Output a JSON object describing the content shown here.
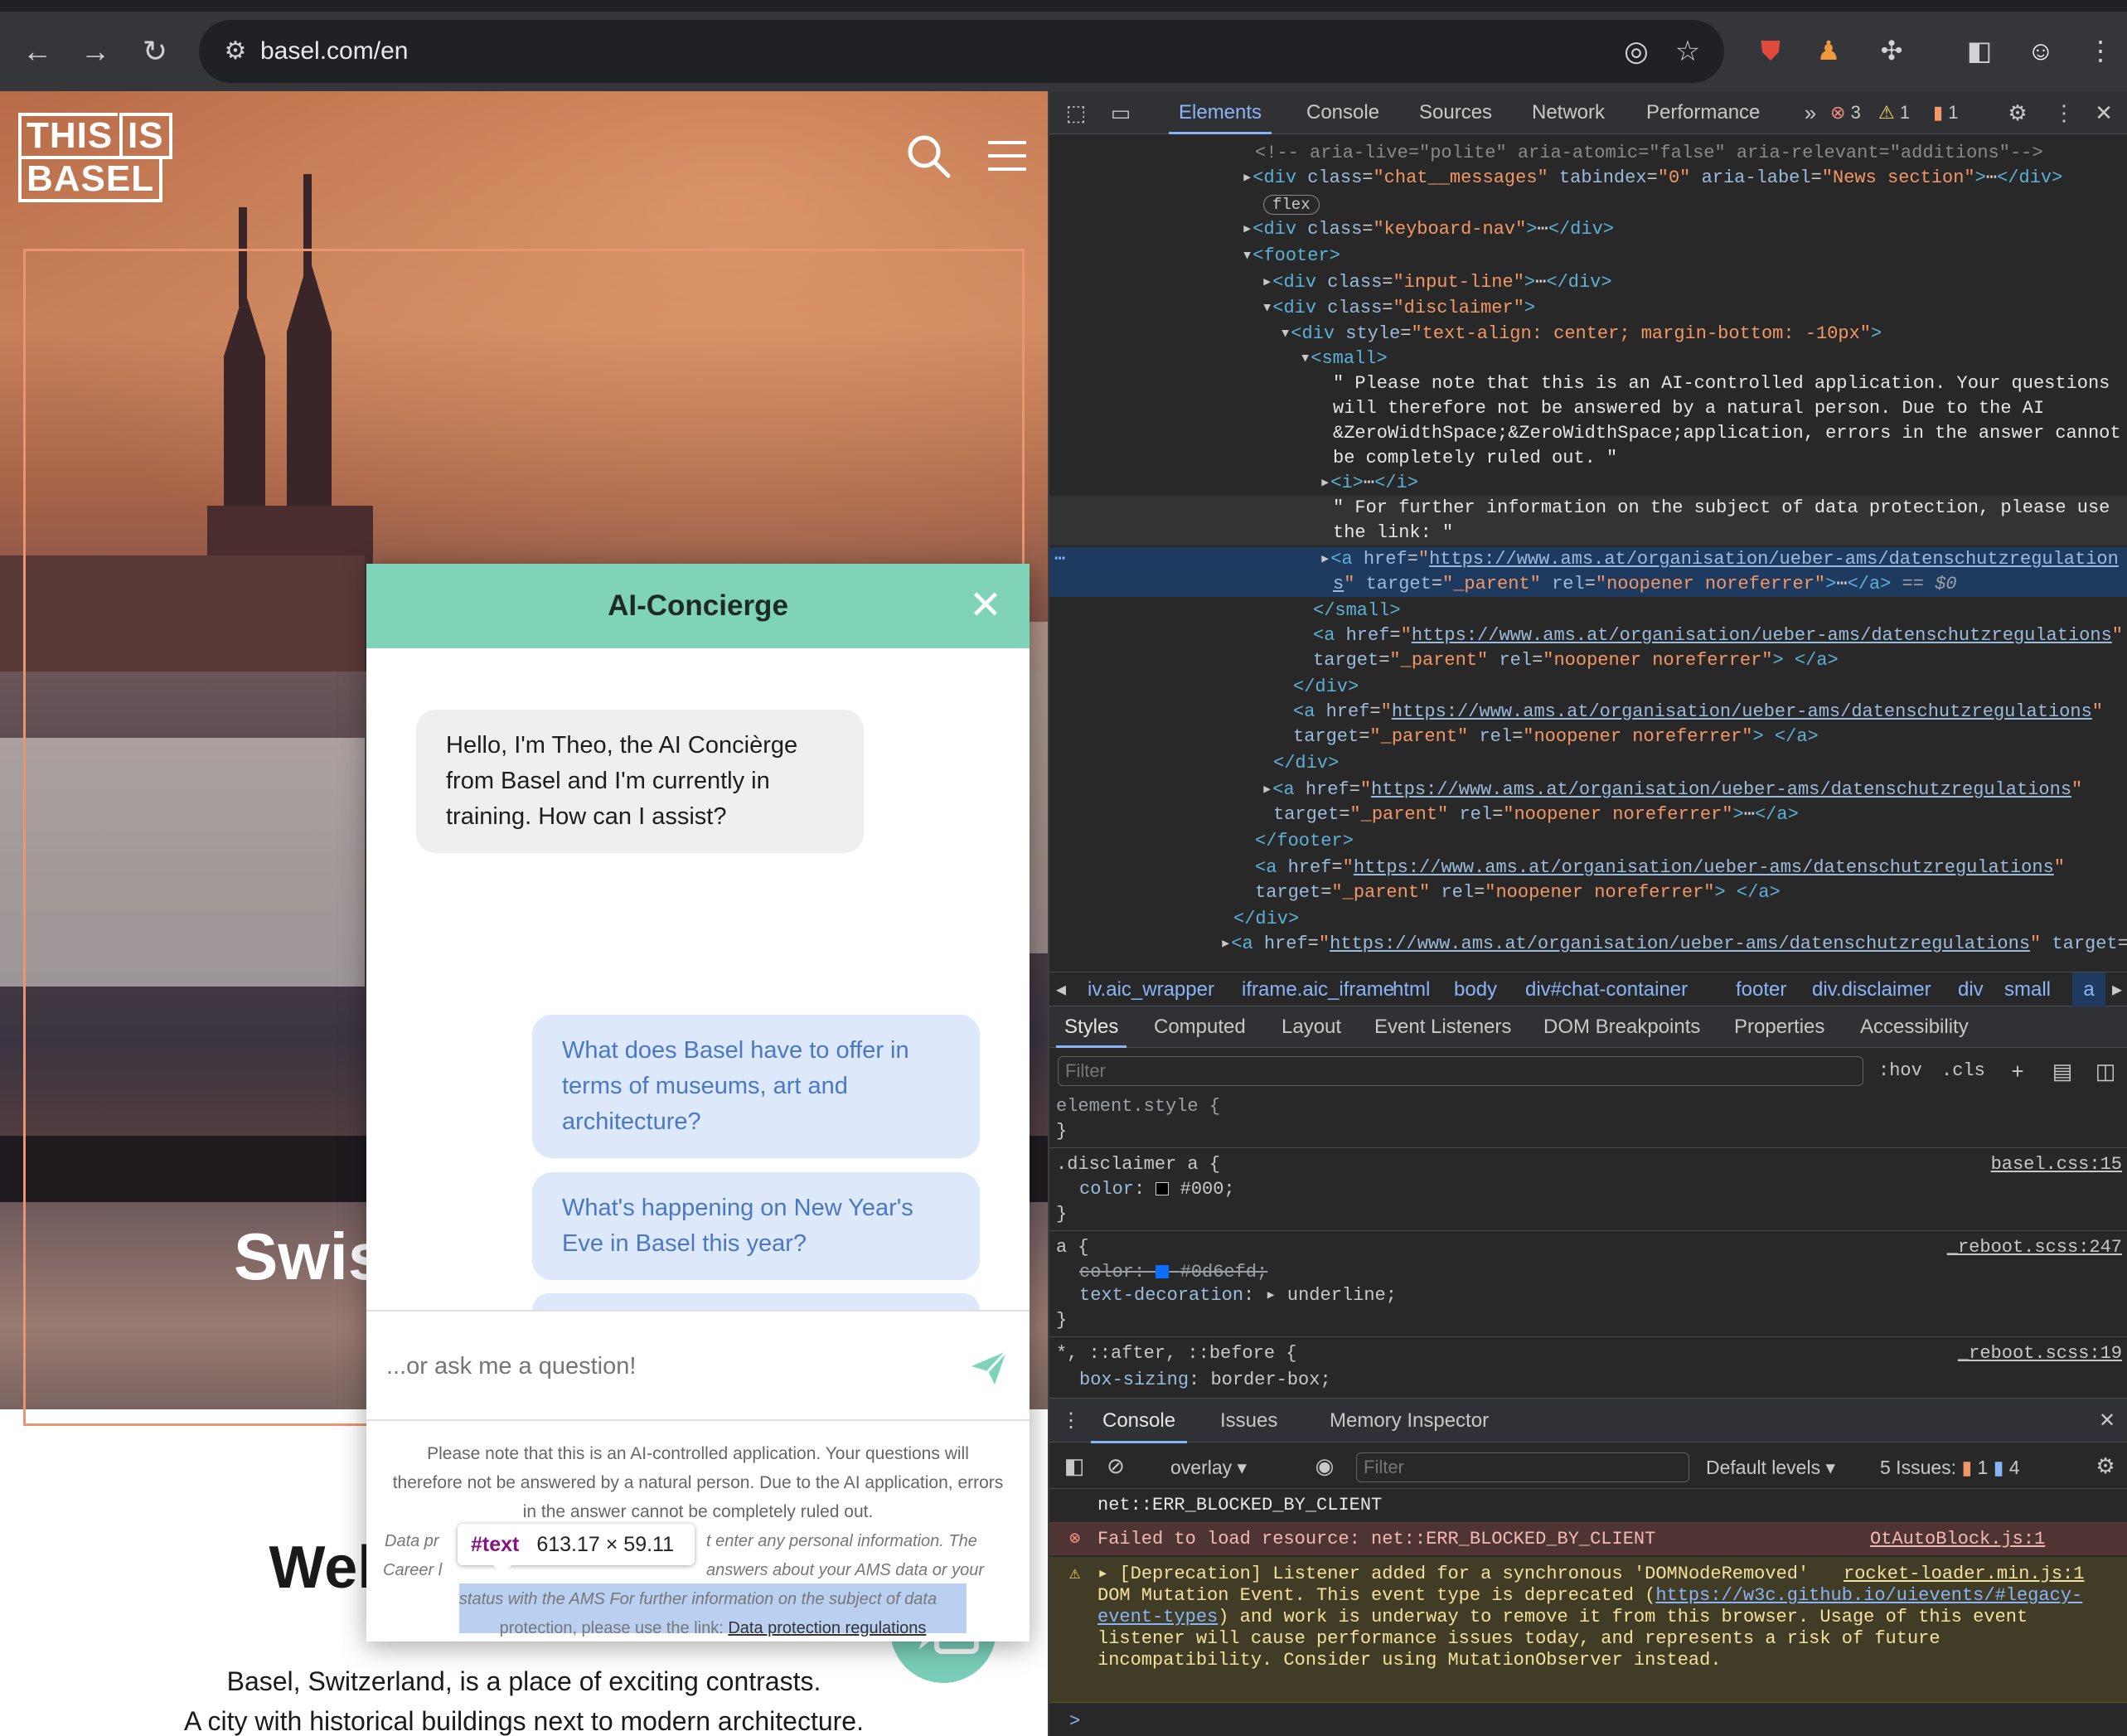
{
  "browser": {
    "url": "basel.com/en"
  },
  "site": {
    "logo_line1a": "THIS",
    "logo_line1b": "IS",
    "logo_line2": "BASEL",
    "hero_heading": "Swis",
    "welcome": "Welcome to Basel",
    "intro_line1": "Basel, Switzerland, is a place of exciting contrasts.",
    "intro_line2": "A city with historical buildings next to modern architecture."
  },
  "chat": {
    "title": "AI-Concierge",
    "bot_message": "Hello, I'm Theo, the AI Concièrge from Basel and I'm currently in training. How can I assist?",
    "suggestion1": "What does Basel have to offer in terms of museums, art and architecture?",
    "suggestion2": "What's happening on New Year's Eve in Basel this year?",
    "input_placeholder": "...or ask me a question!",
    "disclaimer": "Please note that this is an AI-controlled application. Your questions will therefore not be answered by a natural person. Due to the AI application, errors in the answer cannot be completely ruled out.",
    "disclaimer_sub_a": "Data pr",
    "disclaimer_sub_b": "t enter any personal information. The",
    "disclaimer_sub_c": "Career l",
    "disclaimer_sub_d": "answers about your AMS data or your",
    "disclaimer_sub_e": "status with the AMS For further information on the subject of data",
    "disclaimer_sub_f": "protection, please use the link:",
    "disclaimer_link": "Data protection regulations",
    "tooltip_node": "#text",
    "tooltip_size": "613.17 × 59.11"
  },
  "devtools": {
    "tabs": [
      "Elements",
      "Console",
      "Sources",
      "Network",
      "Performance"
    ],
    "errors": "3",
    "warnings": "1",
    "issues": "1",
    "breadcrumbs": [
      "iv.aic_wrapper",
      "iframe.aic_iframe",
      "html",
      "body",
      "div#chat-container",
      "footer",
      "div.disclaimer",
      "div",
      "small",
      "a"
    ],
    "style_tabs": [
      "Styles",
      "Computed",
      "Layout",
      "Event Listeners",
      "DOM Breakpoints",
      "Properties",
      "Accessibility"
    ],
    "filter_placeholder": "Filter",
    "hov": ":hov",
    "cls": ".cls",
    "drawer_tabs": [
      "Console",
      "Issues",
      "Memory Inspector"
    ],
    "console_context": "overlay",
    "console_filter_placeholder": "Filter",
    "default_levels": "Default levels",
    "issues_label": "5 Issues:",
    "issues_warn": "1",
    "issues_info": "4",
    "console_line0": "net::ERR_BLOCKED_BY_CLIENT",
    "console_error": "Failed to load resource: net::ERR_BLOCKED_BY_CLIENT",
    "console_error_src": "OtAutoBlock.js:1",
    "console_warn1": "[Deprecation] Listener added for a synchronous 'DOMNodeRemoved'",
    "console_warn_src": "rocket-loader.min.js:1",
    "console_warn2": "DOM Mutation Event. This event type is deprecated (",
    "console_warn_link1": "https://w3c.github.io/uievents/#legacy-",
    "console_warn_link2": "event-types",
    "console_warn3": ") and work is underway to remove it from this browser. Usage of this event",
    "console_warn4": "listener will cause performance issues today, and represents a risk of future",
    "console_warn5": "incompatibility. Consider using MutationObserver instead.",
    "prompt": ">"
  },
  "dom_lines": {
    "l0": "<!-- aria-live=\"polite\" aria-atomic=\"false\" aria-relevant=\"additions\"-->",
    "flex": "flex",
    "t1": " Please note that this is an AI-controlled application. Your questions",
    "t2": "will therefore not be answered by a natural person. Due to the AI",
    "t3": "&ZeroWidthSpace;&ZeroWidthSpace;application, errors in the answer cannot",
    "t4": "be completely ruled out. \"",
    "t5": "\" For further information on the subject of data protection, please use",
    "t6": "the link: \"",
    "href": "https://www.ams.at/organisation/ueber-ams/datenschutzregulations",
    "href_a": "https://www.ams.at/organisation/ueber-ams/datenschutzregulation",
    "href_b": "s",
    "eq": "== $0"
  },
  "styles": {
    "element_style": "element.style {",
    "disc_sel": ".disclaimer a {",
    "disc_src": "basel.css:15",
    "color_prop": "color",
    "color_val": "#000;",
    "a_sel": "a {",
    "a_src": "_reboot.scss:247",
    "a_color": "color: ",
    "a_color_val": "#0d6efd;",
    "td_prop": "text-decoration",
    "td_val": "underline;",
    "star_sel": "*, ::after, ::before {",
    "star_src": "_reboot.scss:19",
    "bs_prop": "box-sizing",
    "bs_val": "border-box;"
  },
  "colors": {
    "chat_header": "#7fd3b9",
    "suggestion_bg": "#dde9fb",
    "suggestion_text": "#4a78c7",
    "devtools_bg": "#282828",
    "devtools_accent": "#8ab4f8"
  }
}
